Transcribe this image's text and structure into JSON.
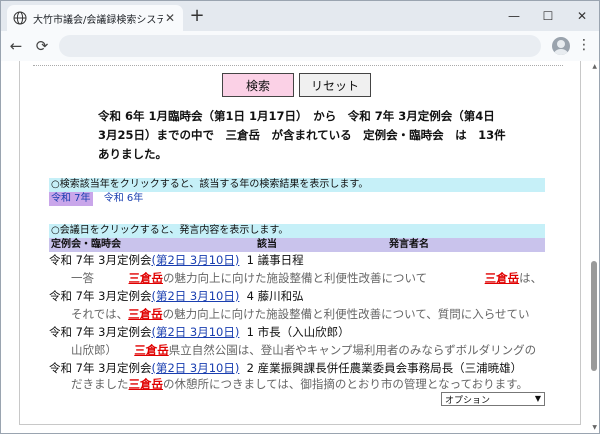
{
  "browser": {
    "tab_title": "大竹市議会/会議録検索システム",
    "tab_close": "✕",
    "new_tab": "+",
    "win_minimize": "—",
    "win_maximize": "☐",
    "win_close": "✕",
    "back": "←",
    "reload": "⟳",
    "menu": "⋮"
  },
  "page": {
    "search_button": "検索",
    "reset_button": "リセット",
    "summary": "令和 6年 1月臨時会（第1日 1月17日）　から　令和 7年 3月定例会（第4日 3月25日）までの中で　三倉岳　が含まれている　定例会・臨時会　は　13件　ありました。",
    "year_hint": "○検索該当年をクリックすると、該当する年の検索結果を表示します。",
    "years": [
      "令和 7年",
      "令和 6年"
    ],
    "date_hint": "○会議日をクリックすると、発言内容を表示します。",
    "columns": {
      "meeting": "定例会・臨時会",
      "date": "該当",
      "speaker": "発言者名"
    },
    "keyword": "三倉岳",
    "results": [
      {
        "meeting": "令和 7年 3月定例会",
        "date": "(第2日 3月10日)",
        "speaker": "1  議事日程",
        "ex_a": "一答　　　",
        "ex_b": "の魅力向上に向けた施設整備と利便性改善について　　　　　",
        "ex_c": "は、"
      },
      {
        "meeting": "令和 7年 3月定例会",
        "date": "(第2日 3月10日)",
        "speaker": "4  藤川和弘",
        "ex_a": "それでは、",
        "ex_b": "の魅力向上に向けた施設整備と利便性改善について、質問に入らせてい",
        "ex_c": ""
      },
      {
        "meeting": "令和 7年 3月定例会",
        "date": "(第2日 3月10日)",
        "speaker": "1  市長（入山欣郎）",
        "ex_a": "山欣郎）　　",
        "ex_b": "県立自然公園は、登山者やキャンプ場利用者のみならずボルダリングの",
        "ex_c": ""
      },
      {
        "meeting": "令和 7年 3月定例会",
        "date": "(第2日 3月10日)",
        "speaker": "2  産業振興課長併任農業委員会事務局長（三浦暁雄）",
        "ex_a": "だきました",
        "ex_b": "の休憩所につきましては、御指摘のとおり市の管理となっております。",
        "ex_c": ""
      }
    ],
    "option_select": "オプション"
  }
}
